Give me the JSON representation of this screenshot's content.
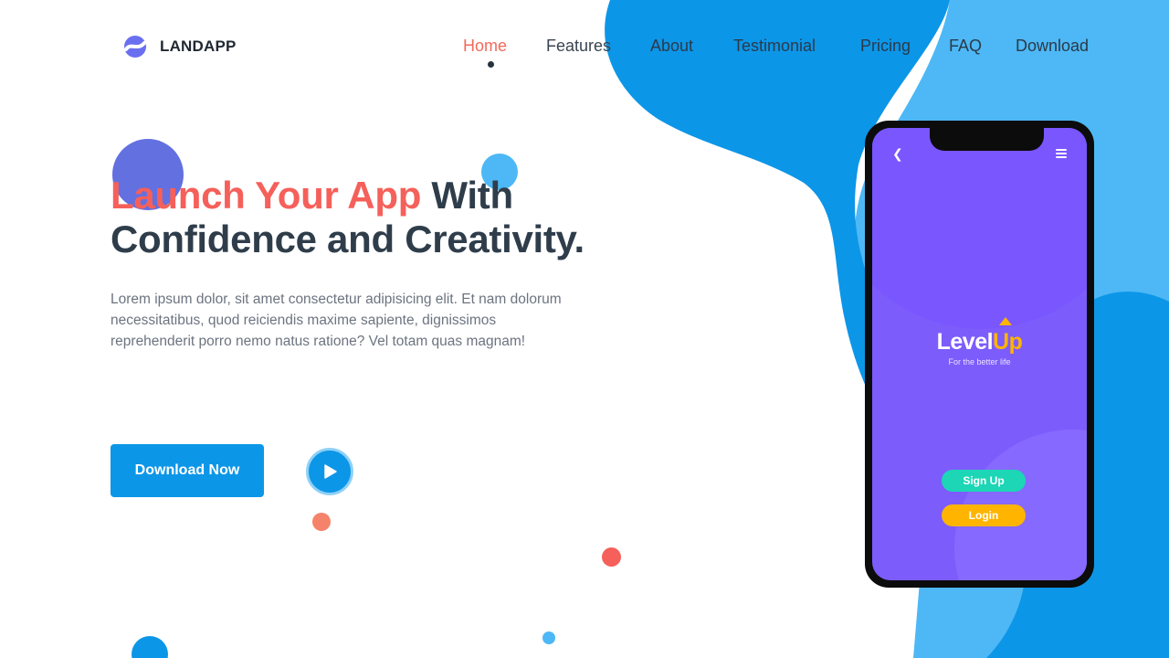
{
  "brand": {
    "name": "LANDAPP"
  },
  "nav": {
    "items": [
      {
        "label": "Home",
        "active": true
      },
      {
        "label": "Features"
      },
      {
        "label": "About"
      },
      {
        "label": "Testimonial"
      },
      {
        "label": "Pricing"
      },
      {
        "label": "FAQ"
      },
      {
        "label": "Download"
      }
    ]
  },
  "hero": {
    "title_highlight": "Launch Your App",
    "title_rest": " With Confidence and Creativity.",
    "description": "Lorem ipsum dolor, sit amet consectetur adipisicing elit. Et nam dolorum necessitatibus, quod reiciendis maxime sapiente, dignissimos reprehenderit porro nemo natus ratione? Vel totam quas magnam!",
    "download_label": "Download Now"
  },
  "phone": {
    "brand_primary": "Level",
    "brand_accent": "Up",
    "tagline": "For the better life",
    "signup_label": "Sign Up",
    "login_label": "Login"
  },
  "colors": {
    "accent_red": "#f5605a",
    "primary_blue": "#0c96e8",
    "light_blue": "#4db8f5",
    "heading": "#2f3d4b",
    "phone_purple": "#7d5cfc",
    "signup_green": "#1cd6b6",
    "login_yellow": "#ffb400"
  },
  "icons": {
    "logo": "logo-mark-icon",
    "play": "play-icon",
    "back": "chevron-left-icon",
    "menu": "hamburger-menu-icon",
    "brand_arrow": "arrow-up-icon"
  }
}
